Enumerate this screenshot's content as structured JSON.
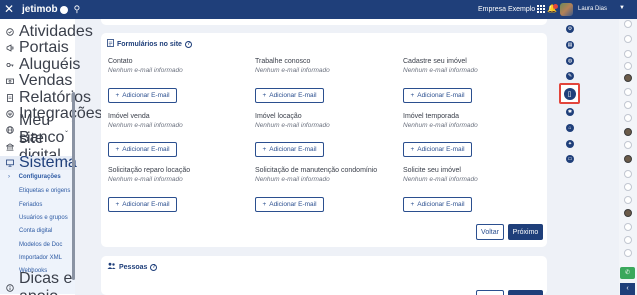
{
  "topbar": {
    "brand": "jetimob",
    "company": "Empresa Exemplo",
    "user": "Laura Dias"
  },
  "sidebar": {
    "items": [
      {
        "label": "Atividades",
        "icon": "check-circle-icon"
      },
      {
        "label": "Portais",
        "icon": "megaphone-icon"
      },
      {
        "label": "Aluguéis",
        "icon": "key-icon"
      },
      {
        "label": "Vendas",
        "icon": "money-icon"
      },
      {
        "label": "Relatórios",
        "icon": "report-icon"
      },
      {
        "label": "Integrações",
        "icon": "plug-icon"
      },
      {
        "label": "Meu site",
        "icon": "globe-icon"
      },
      {
        "label": "Banco digital",
        "icon": "bank-icon"
      },
      {
        "label": "Sistema",
        "icon": "monitor-icon"
      }
    ],
    "submenu": [
      "Configurações",
      "Etiquetas e origens",
      "Feriados",
      "Usuários e grupos",
      "Conta digital",
      "Modelos de Doc",
      "Importador XML",
      "Webhooks"
    ],
    "footer": "Dicas e apoio"
  },
  "forms_section": {
    "title": "Formulários no site",
    "empty_text": "Nenhum e-mail informado",
    "add_label": "Adicionar E-mail",
    "fields": [
      "Contato",
      "Trabalhe conosco",
      "Cadastre seu imóvel",
      "Imóvel venda",
      "Imóvel locação",
      "Imóvel temporada",
      "Solicitação reparo locação",
      "Solicitação de manutenção condomínio",
      "Solicite seu imóvel"
    ],
    "back_label": "Voltar",
    "next_label": "Próximo"
  },
  "people_section": {
    "title": "Pessoas"
  },
  "colors": {
    "primary": "#1f3f7a",
    "highlight": "#e2453c",
    "whatsapp": "#3aa85c"
  }
}
